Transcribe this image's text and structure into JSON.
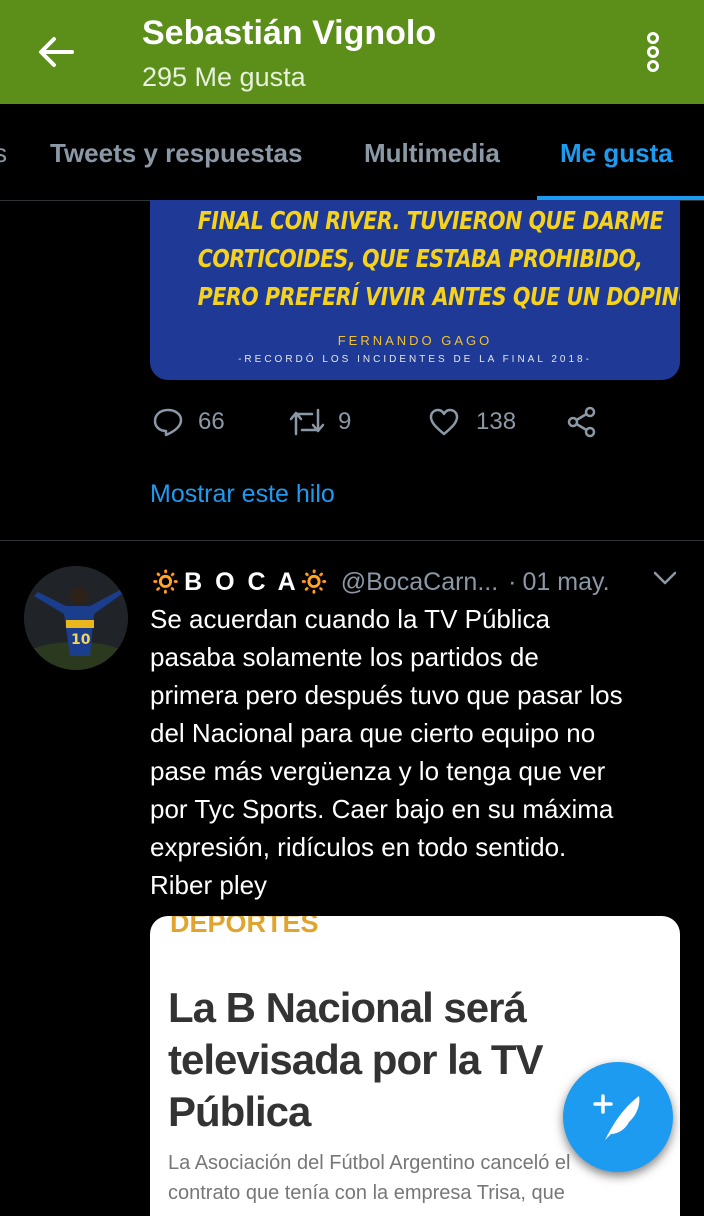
{
  "header": {
    "title": "Sebastián Vignolo",
    "subtitle": "295 Me gusta",
    "color": "#5b8f1a"
  },
  "tabs": [
    {
      "label": "Tweets y respuestas",
      "active": false
    },
    {
      "label": "Multimedia",
      "active": false
    },
    {
      "label": "Me gusta",
      "active": true
    }
  ],
  "tweet1": {
    "media_quote": [
      "FINAL CON RIVER. TUVIERON QUE DARME",
      "CORTICOIDES, QUE ESTABA PROHIBIDO,",
      "PERO PREFERÍ VIVIR ANTES QUE UN DOPING”"
    ],
    "media_author": "FERNANDO GAGO",
    "media_note": "-RECORDÓ LOS INCIDENTES DE LA FINAL 2018-",
    "replies": "66",
    "retweets": "9",
    "likes": "138",
    "show_thread": "Mostrar este hilo"
  },
  "tweet2": {
    "name": "🔅B O C A🔅",
    "handle": "@BocaCarn...",
    "dot": "·",
    "date": "01 may.",
    "text_lines": [
      "Se acuerdan cuando la TV Pública",
      "pasaba solamente los partidos de",
      "primera pero después tuvo que pasar los",
      "del Nacional para que cierto equipo no",
      "pase más vergüenza y lo tenga que ver",
      "por Tyc Sports. Caer bajo en su máxima",
      "expresión, ridículos en todo sentido.",
      "Riber pley"
    ],
    "card": {
      "section": "DEPORTES",
      "headline_lines": [
        "La B Nacional será",
        "televisada por la TV",
        "Pública"
      ],
      "body_lines": [
        "La Asociación del Fútbol Argentino canceló el",
        "contrato que tenía con la empresa Trisa, que"
      ]
    }
  },
  "colors": {
    "accent": "#1d9bf0",
    "secondary_text": "#8b98a5",
    "background": "#000000"
  }
}
